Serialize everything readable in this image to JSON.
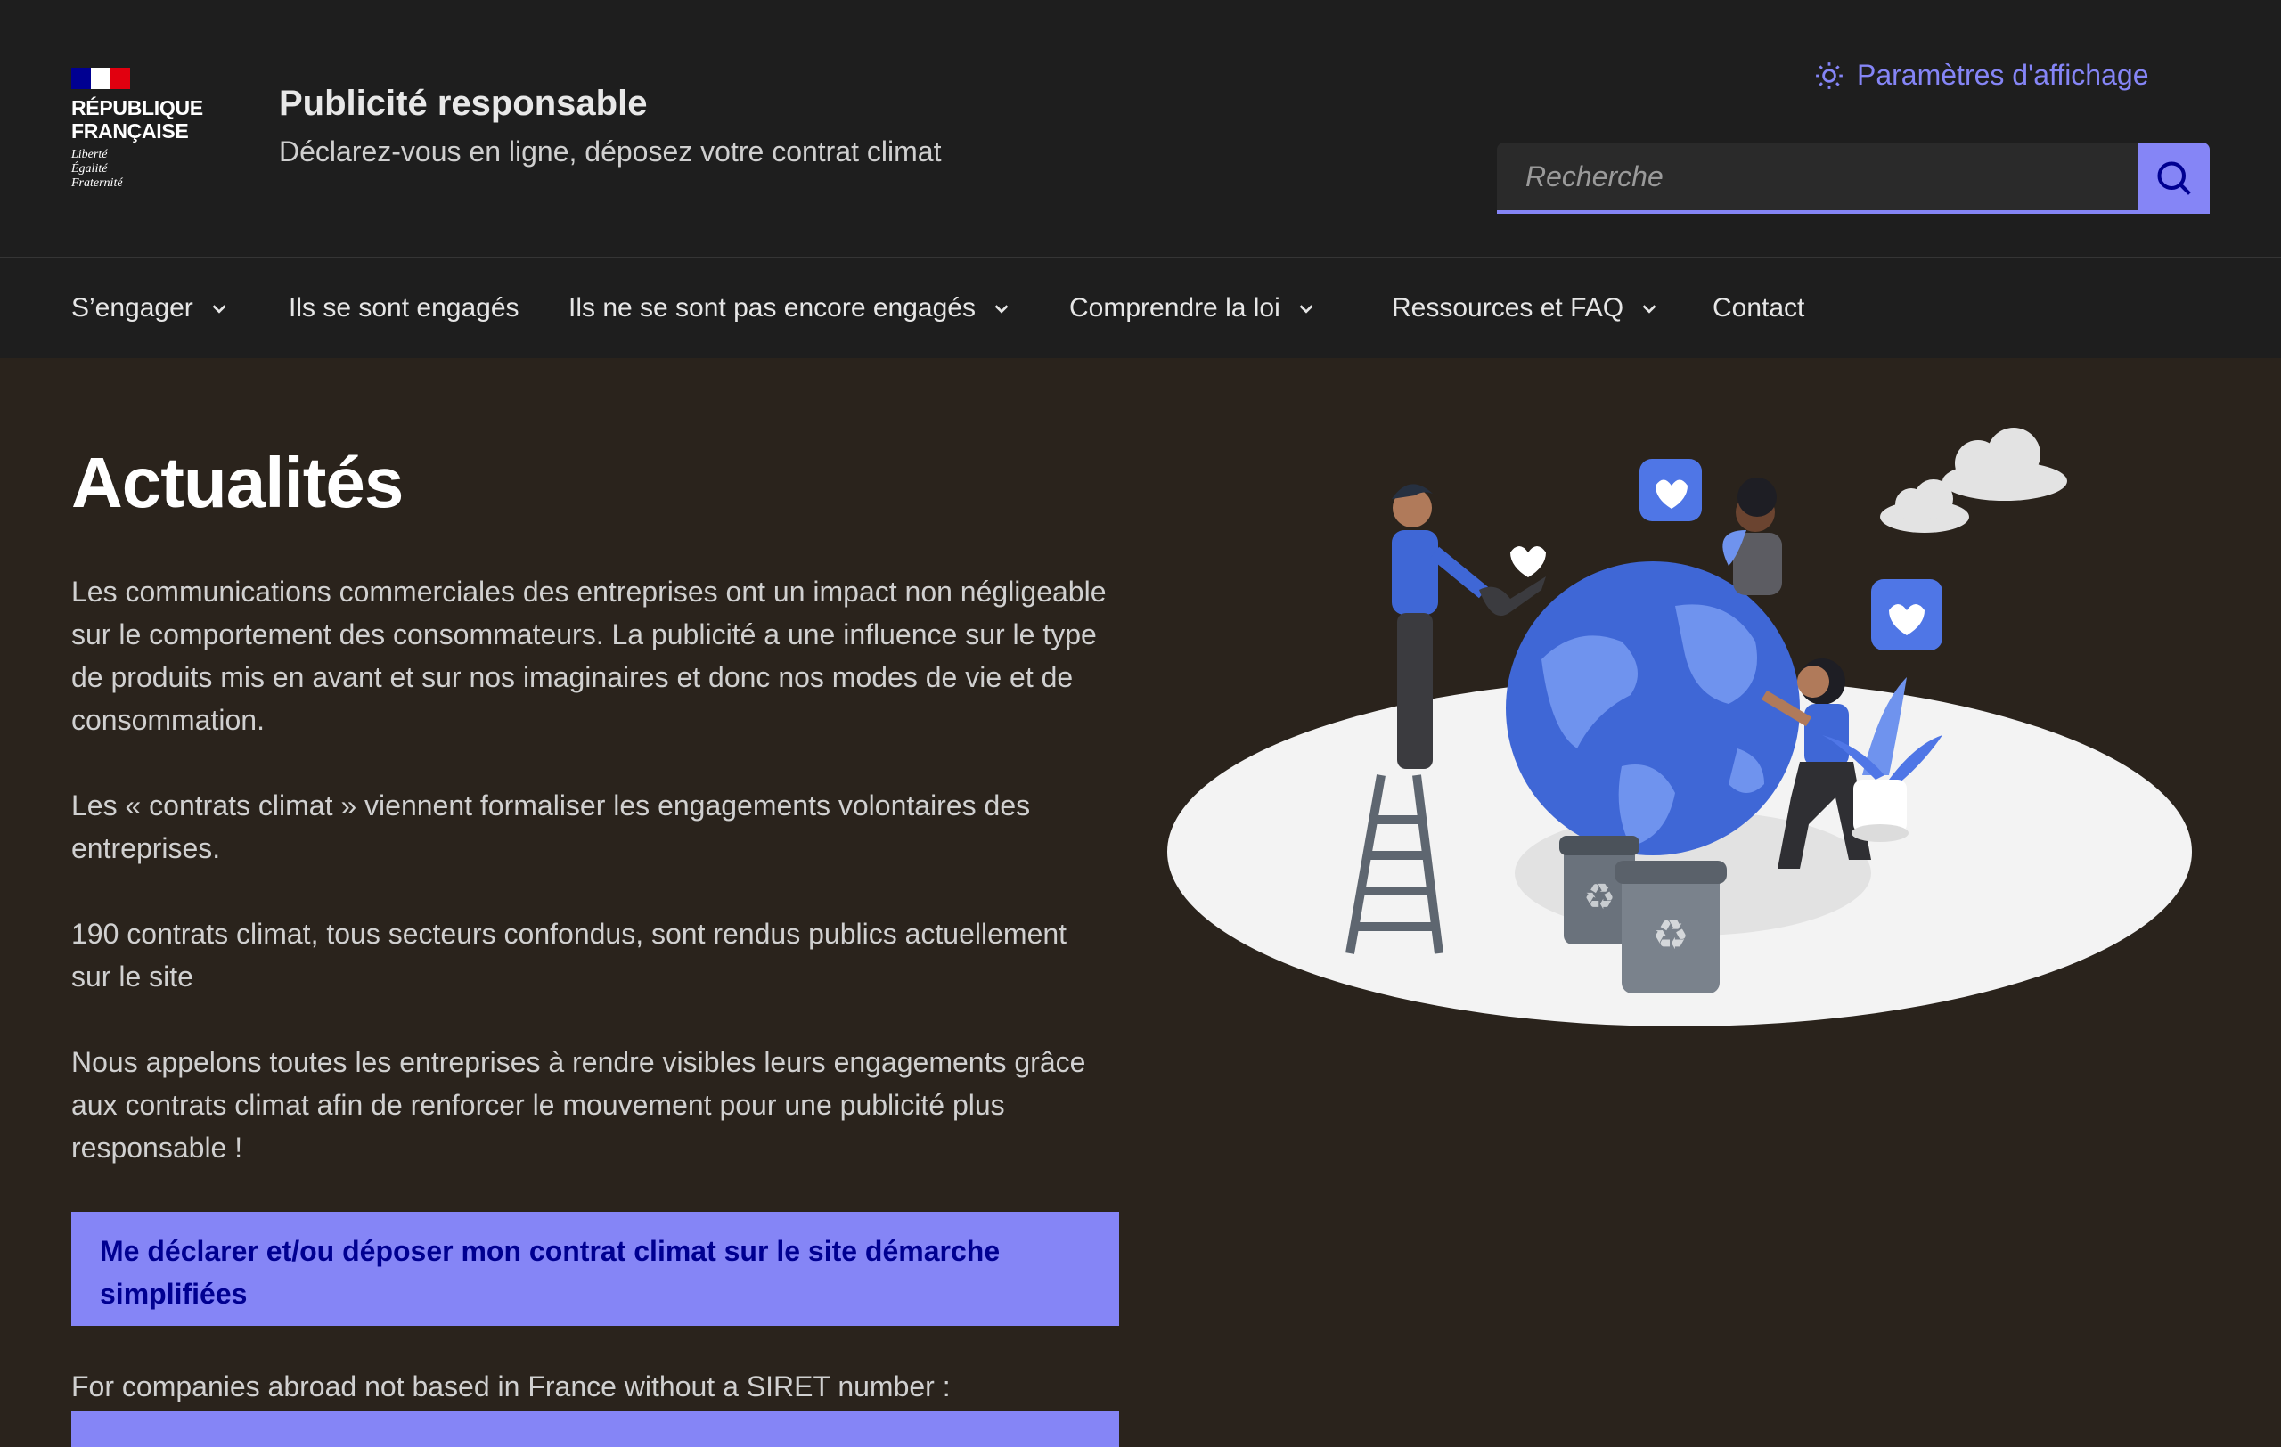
{
  "header": {
    "logo": {
      "line1": "RÉPUBLIQUE",
      "line2": "FRANÇAISE",
      "motto1": "Liberté",
      "motto2": "Égalité",
      "motto3": "Fraternité"
    },
    "site_title": "Publicité responsable",
    "site_tagline": "Déclarez-vous en ligne, déposez votre contrat climat",
    "display_settings_label": "Paramètres d'affichage",
    "search": {
      "placeholder": "Recherche",
      "button_icon": "search-icon"
    }
  },
  "nav": {
    "items": [
      {
        "label": "S’engager",
        "has_dropdown": true
      },
      {
        "label": "Ils se sont engagés",
        "has_dropdown": false
      },
      {
        "label": "Ils ne se sont pas encore engagés",
        "has_dropdown": true
      },
      {
        "label": "Comprendre la loi",
        "has_dropdown": true
      },
      {
        "label": "Ressources et FAQ",
        "has_dropdown": true
      },
      {
        "label": "Contact",
        "has_dropdown": false
      }
    ]
  },
  "main": {
    "title": "Actualités",
    "paragraphs": [
      "Les communications commerciales des entreprises ont un impact non négligeable sur le comportement des consommateurs. La publicité a une influence sur le type de produits mis en avant et sur nos imaginaires et donc nos modes de vie et de consommation.",
      "Les « contrats climat » viennent formaliser les engagements volontaires des entreprises.",
      "190 contrats climat, tous secteurs confondus, sont rendus publics actuellement sur le site",
      "Nous appelons toutes les entreprises à rendre visibles leurs engagements grâce aux contrats climat afin de renforcer le mouvement pour une publicité plus responsable !"
    ],
    "cta_label": "Me déclarer et/ou déposer mon contrat climat sur le site démarche simplifiées",
    "abroad_text": "For companies abroad not based in France without a SIRET number :"
  },
  "colors": {
    "accent": "#8585f6",
    "header_bg": "#1e1e1e",
    "page_bg": "#2a231c",
    "cta_text": "#000091"
  }
}
